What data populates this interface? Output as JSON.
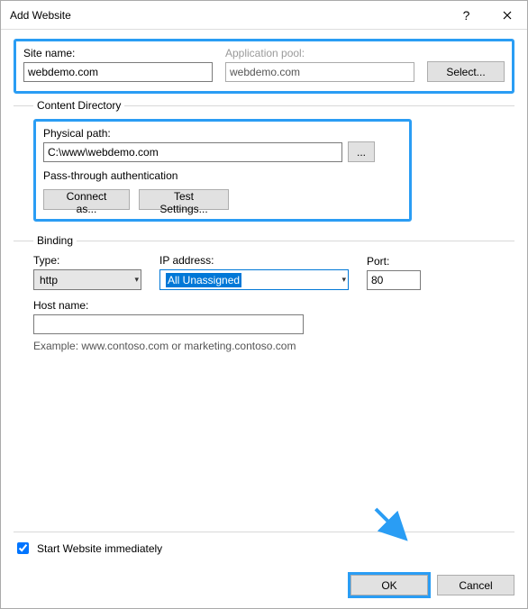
{
  "title": "Add Website",
  "siteName": {
    "label": "Site name:",
    "value": "webdemo.com"
  },
  "appPool": {
    "label": "Application pool:",
    "value": "webdemo.com",
    "selectBtn": "Select..."
  },
  "contentDir": {
    "legend": "Content Directory",
    "physicalPathLabel": "Physical path:",
    "physicalPathValue": "C:\\www\\webdemo.com",
    "browseBtn": "...",
    "passThrough": "Pass-through authentication",
    "connectAs": "Connect as...",
    "testSettings": "Test Settings..."
  },
  "binding": {
    "legend": "Binding",
    "typeLabel": "Type:",
    "typeValue": "http",
    "ipLabel": "IP address:",
    "ipValue": "All Unassigned",
    "portLabel": "Port:",
    "portValue": "80",
    "hostLabel": "Host name:",
    "hostValue": "",
    "example": "Example: www.contoso.com or marketing.contoso.com"
  },
  "startImmediately": "Start Website immediately",
  "ok": "OK",
  "cancel": "Cancel"
}
